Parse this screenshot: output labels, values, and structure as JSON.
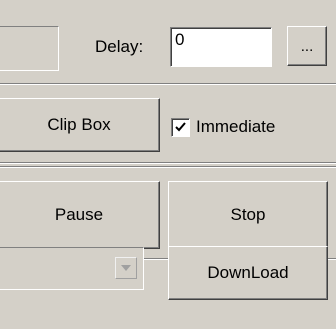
{
  "delay": {
    "label": "Delay:",
    "value": "0",
    "browse_label": "..."
  },
  "clip": {
    "button_label": "Clip Box",
    "immediate_label": "Immediate",
    "immediate_checked": true
  },
  "controls": {
    "pause_label": "Pause",
    "stop_label": "Stop"
  },
  "download": {
    "button_label": "DownLoad",
    "combo_value": ""
  },
  "icons": {
    "check": "checkmark-icon",
    "combo_arrow": "chevron-down-icon"
  }
}
